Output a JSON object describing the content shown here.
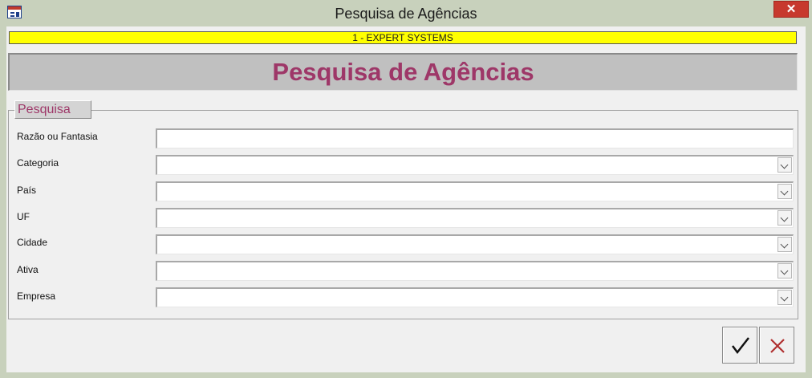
{
  "window": {
    "title": "Pesquisa de Agências",
    "close_glyph": "✕"
  },
  "form": {
    "company": "1 - EXPERT SYSTEMS",
    "heading": "Pesquisa de Agências",
    "group_label": "Pesquisa",
    "fields": [
      {
        "label": "Razão ou Fantasia",
        "type": "text",
        "value": ""
      },
      {
        "label": "Categoria",
        "type": "select",
        "value": ""
      },
      {
        "label": "País",
        "type": "select",
        "value": ""
      },
      {
        "label": "UF",
        "type": "select",
        "value": ""
      },
      {
        "label": "Cidade",
        "type": "select",
        "value": ""
      },
      {
        "label": "Ativa",
        "type": "select",
        "value": ""
      },
      {
        "label": "Empresa",
        "type": "select",
        "value": ""
      }
    ]
  },
  "buttons": {
    "confirm_icon": "checkmark-icon",
    "cancel_icon": "x-icon",
    "cancel_color": "#b03030"
  }
}
